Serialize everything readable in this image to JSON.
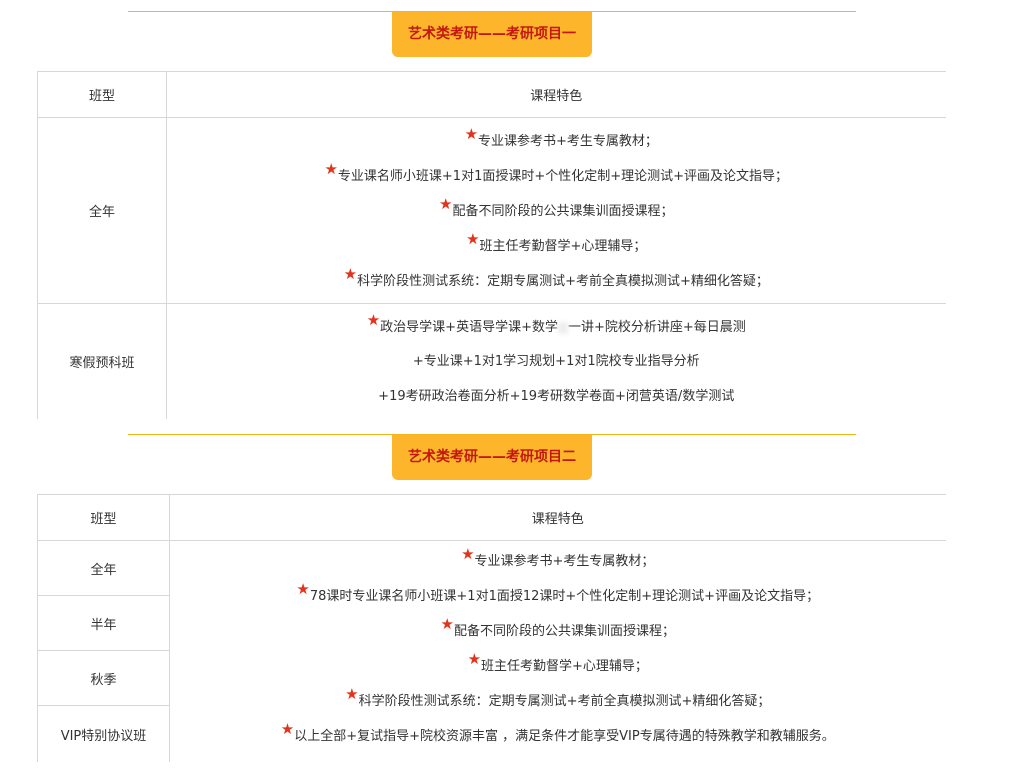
{
  "section1": {
    "title": "艺术类考研——考研项目一",
    "header": {
      "col1": "班型",
      "col2": "课程特色"
    },
    "rows": [
      {
        "type": "全年",
        "features": [
          {
            "star": true,
            "text": "专业课参考书+考生专属教材；"
          },
          {
            "star": true,
            "text": "专业课名师小班课+1对1面授课时+个性化定制+理论测试+评画及论文指导；"
          },
          {
            "star": true,
            "text": "配备不同阶段的公共课集训面授课程；"
          },
          {
            "star": true,
            "text": "班主任考勤督学+心理辅导；"
          },
          {
            "star": true,
            "text": "科学阶段性测试系统：定期专属测试+考前全真模拟测试+精细化答疑；"
          }
        ]
      },
      {
        "type": "寒假预科班",
        "features": [
          {
            "star": true,
            "text_a": "政治导学课+英语导学课+数学",
            "text_b": "一讲+院校分析讲座+每日晨测"
          },
          {
            "star": false,
            "text": "+专业课+1对1学习规划+1对1院校专业指导分析"
          },
          {
            "star": false,
            "text": "+19考研政治卷面分析+19考研数学卷面+闭营英语/数学测试"
          }
        ]
      }
    ]
  },
  "section2": {
    "title": "艺术类考研——考研项目二",
    "header": {
      "col1": "班型",
      "col2": "课程特色"
    },
    "types": [
      "全年",
      "半年",
      "秋季",
      "VIP特别协议班"
    ],
    "features": [
      {
        "star": true,
        "text": "专业课参考书+考生专属教材；"
      },
      {
        "star": true,
        "text": "78课时专业课名师小班课+1对1面授12课时+个性化定制+理论测试+评画及论文指导；"
      },
      {
        "star": true,
        "text": "配备不同阶段的公共课集训面授课程；"
      },
      {
        "star": true,
        "text": "班主任考勤督学+心理辅导；"
      },
      {
        "star": true,
        "text": "科学阶段性测试系统：定期专属测试+考前全真模拟测试+精细化答疑；"
      },
      {
        "star": true,
        "text": "以上全部+复试指导+院校资源丰富 ，满足条件才能享受VIP专属待遇的特殊教学和教辅服务。"
      }
    ]
  },
  "icons": {
    "star": "★"
  },
  "colors": {
    "accent": "#fdb52b",
    "title_text": "#c3170f",
    "star": "#e2331d",
    "line": "#f5b31c",
    "border": "#d7d7d7"
  }
}
